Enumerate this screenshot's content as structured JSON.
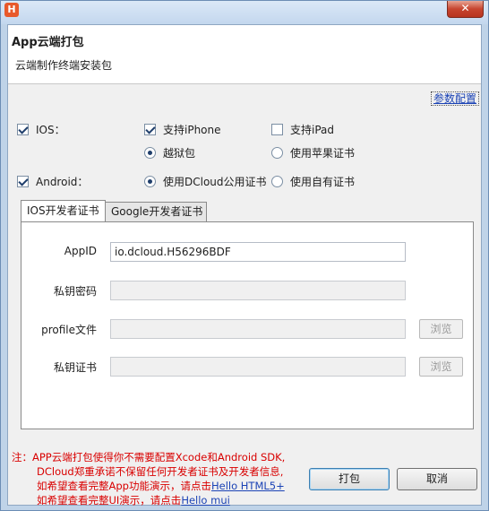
{
  "window": {
    "app_icon_glyph": "H",
    "close_glyph": "✕"
  },
  "header": {
    "title": "App云端打包",
    "subtitle": "云端制作终端安装包"
  },
  "settings_link": "参数配置",
  "platforms": {
    "ios": {
      "label": "IOS：",
      "checked": true
    },
    "support_iphone": {
      "label": "支持iPhone",
      "checked": true
    },
    "support_ipad": {
      "label": "支持iPad",
      "checked": false
    },
    "jailbreak": {
      "label": "越狱包",
      "selected": true
    },
    "apple_cert": {
      "label": "使用苹果证书",
      "selected": false
    },
    "android": {
      "label": "Android：",
      "checked": true
    },
    "dcloud_cert": {
      "label": "使用DCloud公用证书",
      "selected": true
    },
    "own_cert": {
      "label": "使用自有证书",
      "selected": false
    }
  },
  "tabs": [
    {
      "label": "IOS开发者证书",
      "active": true
    },
    {
      "label": "Google开发者证书",
      "active": false
    }
  ],
  "form": {
    "appid_label": "AppID",
    "appid_value": "io.dcloud.H56296BDF",
    "key_password_label": "私钥密码",
    "key_password_value": "",
    "profile_label": "profile文件",
    "profile_value": "",
    "private_cert_label": "私钥证书",
    "private_cert_value": "",
    "browse_label": "浏览"
  },
  "note": {
    "line1": "注：APP云端打包使得你不需要配置Xcode和Android SDK,",
    "line2": "DCloud郑重承诺不保留任何开发者证书及开发者信息,",
    "line3_prefix": "如希望查看完整App功能演示，请点击",
    "line3_link": "Hello HTML5+",
    "line4_prefix": "如希望查看完整UI演示，请点击",
    "line4_link": "Hello mui"
  },
  "buttons": {
    "pack": "打包",
    "cancel": "取消"
  },
  "colors": {
    "note_text": "#d90000",
    "link": "#1b43b5",
    "app_icon": "#e8592b"
  }
}
